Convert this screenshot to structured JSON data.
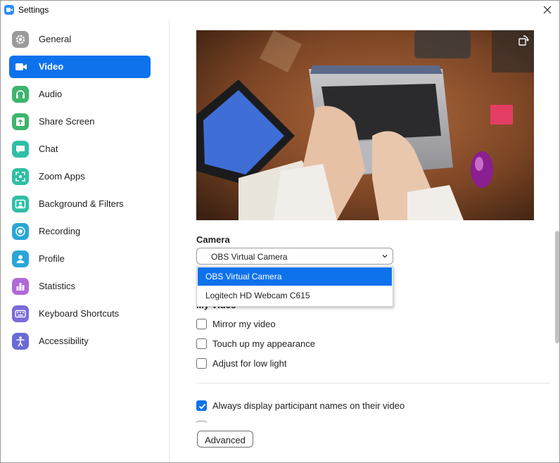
{
  "window": {
    "title": "Settings"
  },
  "sidebar": {
    "items": [
      {
        "label": "General",
        "icon": "gear-icon",
        "color": "#9b9b9b"
      },
      {
        "label": "Video",
        "icon": "video-camera-icon",
        "color": "#0E72ED",
        "active": true
      },
      {
        "label": "Audio",
        "icon": "headphones-icon",
        "color": "#3db46d"
      },
      {
        "label": "Share Screen",
        "icon": "share-screen-icon",
        "color": "#3db46d"
      },
      {
        "label": "Chat",
        "icon": "chat-bubble-icon",
        "color": "#2ebfa5"
      },
      {
        "label": "Zoom Apps",
        "icon": "apps-icon",
        "color": "#2ebfa5"
      },
      {
        "label": "Background & Filters",
        "icon": "background-icon",
        "color": "#2ebfa5"
      },
      {
        "label": "Recording",
        "icon": "record-icon",
        "color": "#2ba6d9"
      },
      {
        "label": "Profile",
        "icon": "person-icon",
        "color": "#2ba6d9"
      },
      {
        "label": "Statistics",
        "icon": "bar-chart-icon",
        "color": "#b06ad8"
      },
      {
        "label": "Keyboard Shortcuts",
        "icon": "keyboard-icon",
        "color": "#7a6ad8"
      },
      {
        "label": "Accessibility",
        "icon": "accessibility-icon",
        "color": "#6a6ad8"
      }
    ]
  },
  "video": {
    "camera_label": "Camera",
    "camera_selected": "OBS Virtual Camera",
    "camera_options": [
      "OBS Virtual Camera",
      "Logitech HD Webcam C615"
    ],
    "my_video_label": "My Video",
    "options": [
      {
        "label": "Mirror my video",
        "checked": false
      },
      {
        "label": "Touch up my appearance",
        "checked": false
      },
      {
        "label": "Adjust for low light",
        "checked": false
      }
    ],
    "always_display": {
      "label": "Always display participant names on their video",
      "checked": true
    },
    "advanced_label": "Advanced"
  },
  "colors": {
    "accent": "#0E72ED"
  }
}
